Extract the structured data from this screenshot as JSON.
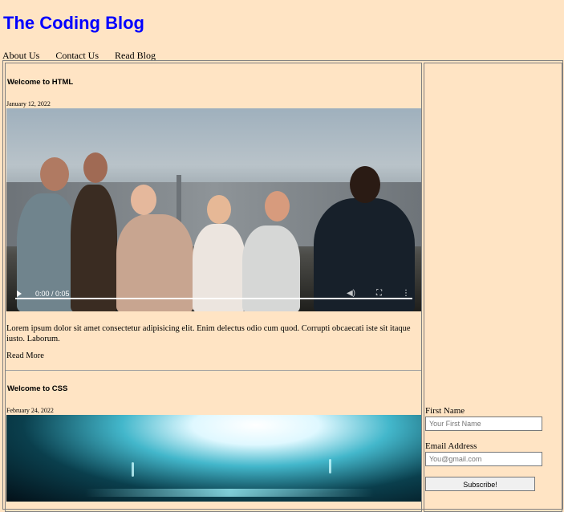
{
  "site": {
    "title": "The Coding Blog"
  },
  "nav": {
    "items": [
      "About Us",
      "Contact Us",
      "Read Blog"
    ]
  },
  "posts": [
    {
      "title": "Welcome to HTML",
      "date": "January 12, 2022",
      "video": {
        "time": "0:00 / 0:05",
        "progress": 0
      },
      "body": "Lorem ipsum dolor sit amet consectetur adipisicing elit. Enim delectus odio cum quod. Corrupti obcaecati iste sit itaque iusto. Laborum.",
      "read_more": "Read More"
    },
    {
      "title": "Welcome to CSS",
      "date": "February 24, 2022"
    }
  ],
  "sidebar": {
    "first_name": {
      "label": "First Name",
      "placeholder": "Your First Name"
    },
    "email": {
      "label": "Email Address",
      "placeholder": "You@gmail.com"
    },
    "subscribe": "Subscribe!"
  },
  "colors": {
    "background": "#ffe4c4",
    "title": "#0000ff"
  },
  "icons": [
    "play-icon",
    "volume-icon",
    "fullscreen-icon",
    "more-options-icon"
  ]
}
